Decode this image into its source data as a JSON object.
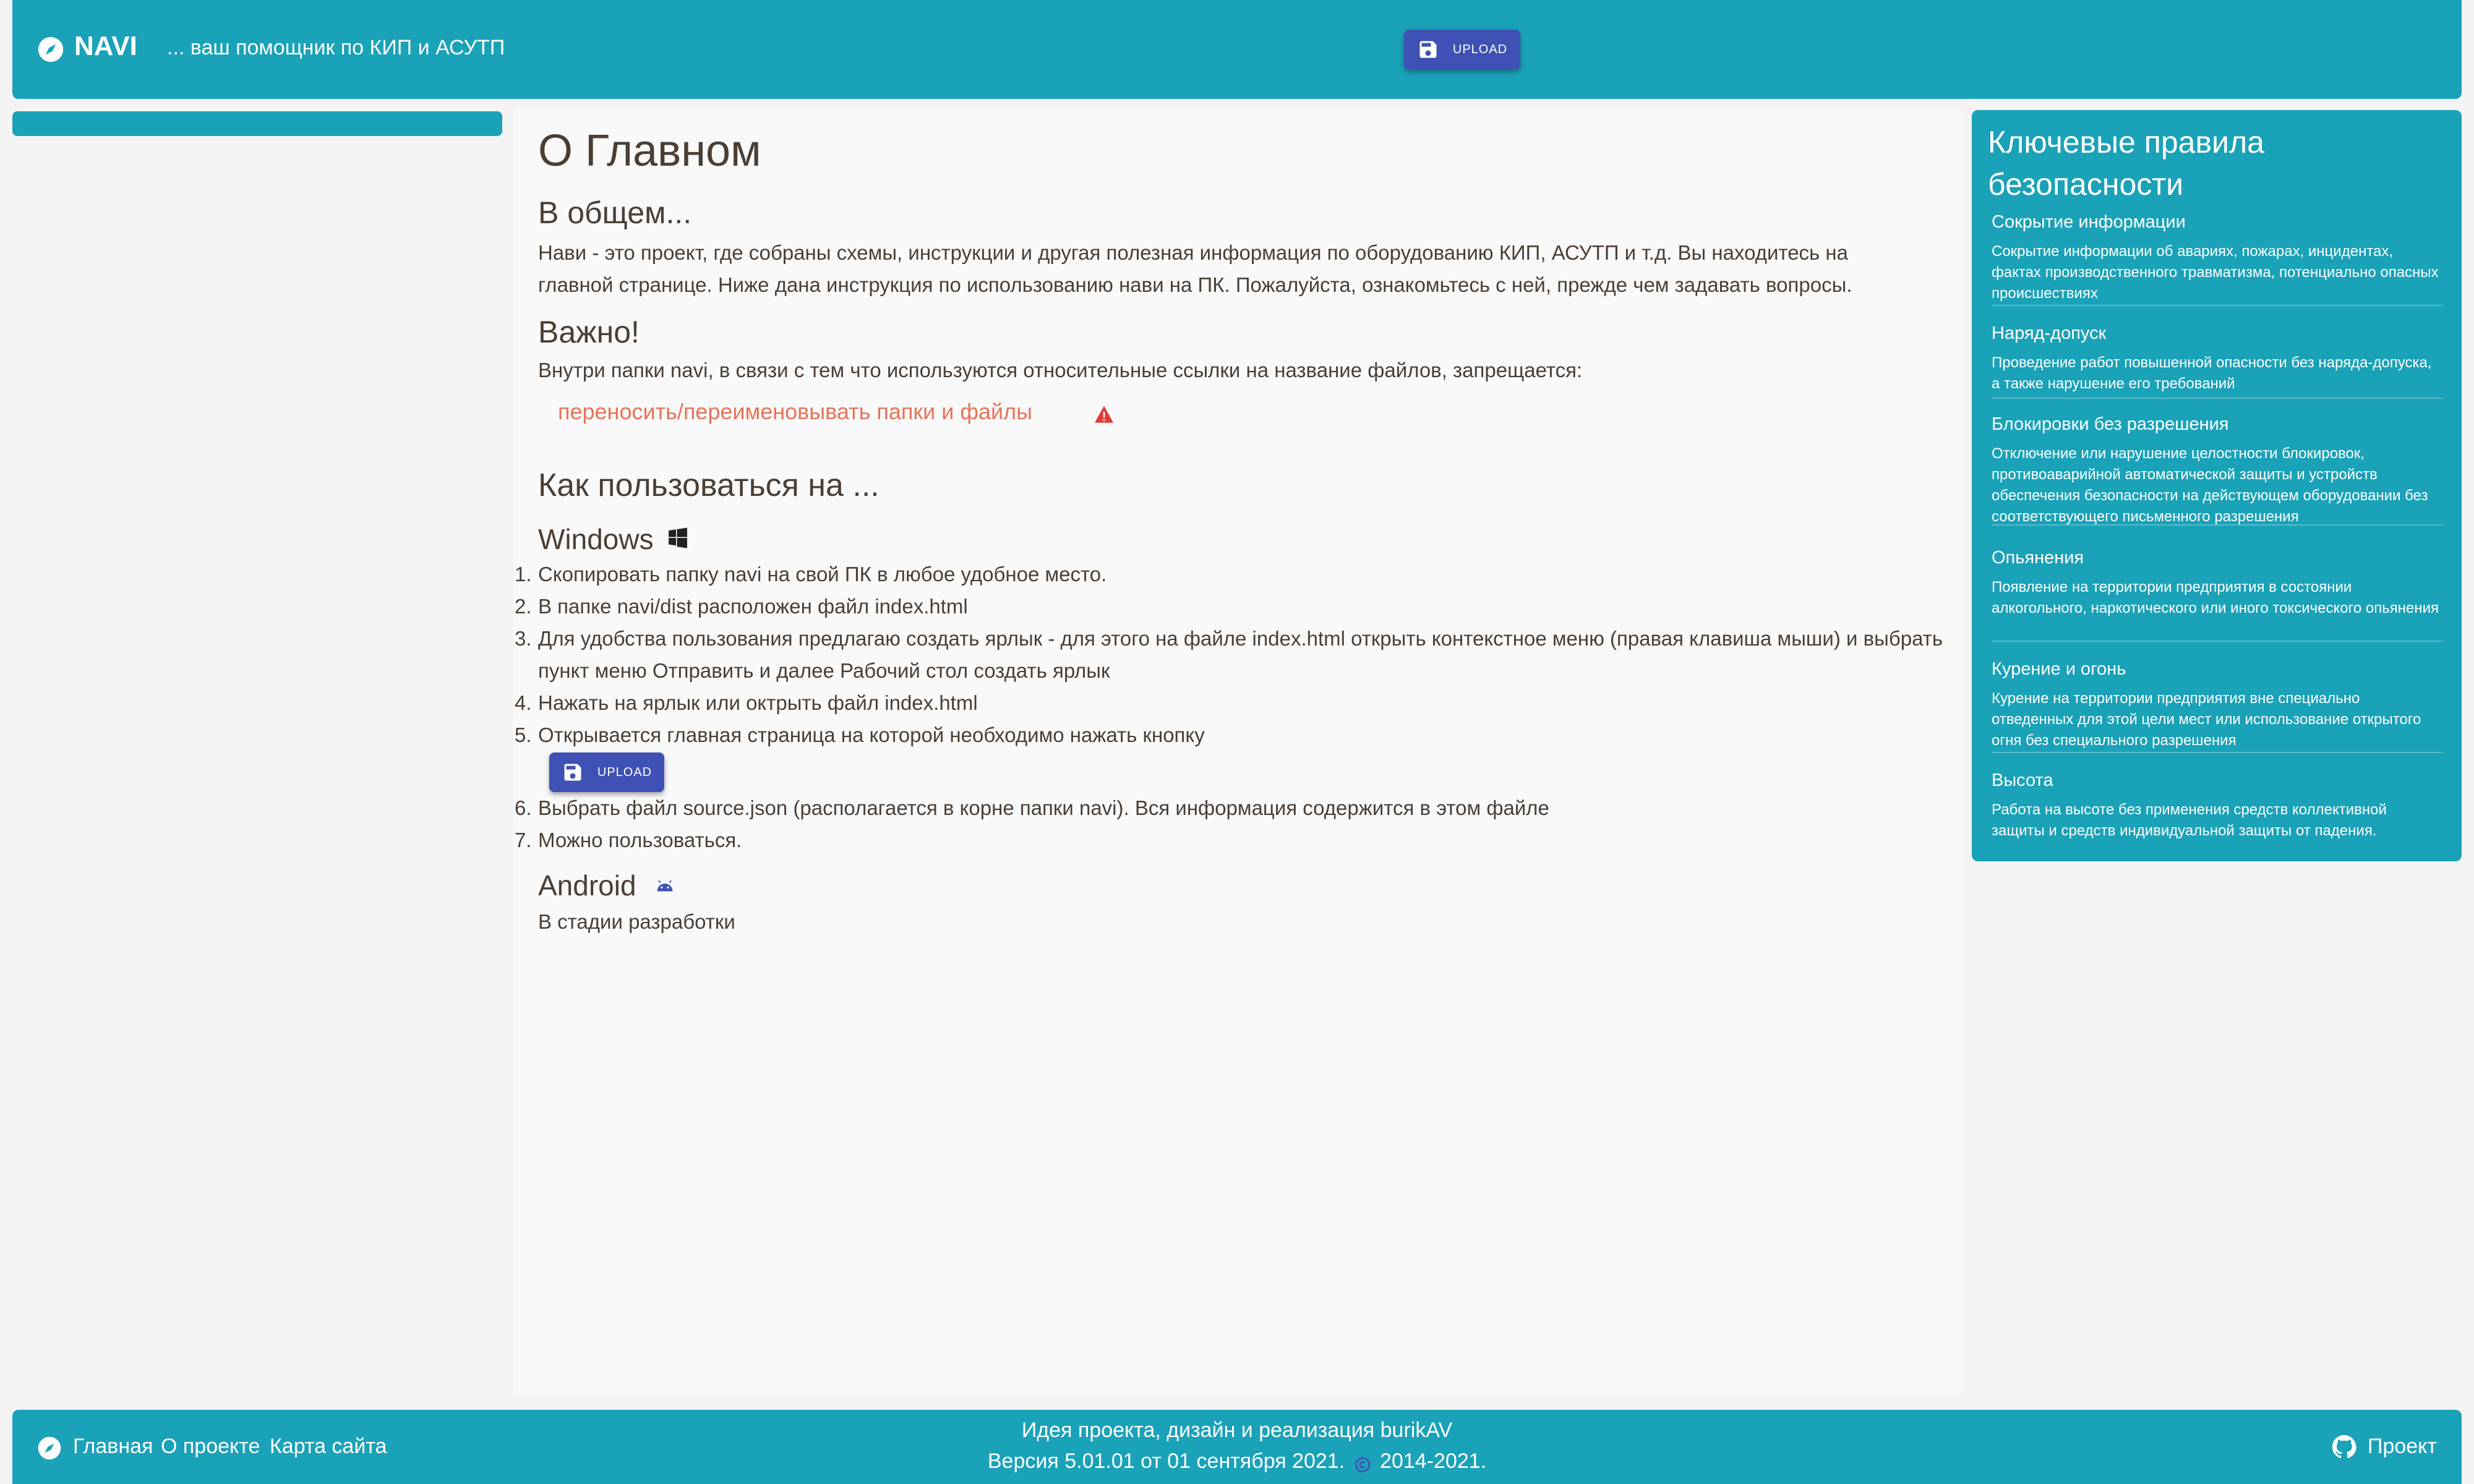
{
  "header": {
    "brand": "NAVI",
    "subtitle": "... ваш помощник по КИП и АСУТП",
    "upload_label": "UPLOAD",
    "logo_icon": "compass-icon"
  },
  "main": {
    "title": "О Главном",
    "general_heading": "В общем...",
    "general_text": "Нави - это проект, где собраны схемы, инструкции и другая полезная информация по оборудованию КИП, АСУТП и т.д. Вы находитесь на главной странице. Ниже дана инструкция по использованию нави на ПК. Пожалуйста, ознакомьтесь с ней, прежде чем задавать вопросы.",
    "important_heading": "Важно!",
    "important_text": "Внутри папки navi, в связи с тем что используются относительные ссылки на название файлов, запрещается:",
    "warning_text": "переносить/переименовывать папки и файлы",
    "howto_heading": "Как пользоваться на ...",
    "windows_heading": "Windows",
    "steps": [
      {
        "num": "1.",
        "text": "Скопировать папку navi на свой ПК в любое удобное место."
      },
      {
        "num": "2.",
        "text": "В папке navi/dist расположен файл index.html"
      },
      {
        "num": "3.",
        "text": "Для удобства пользования предлагаю создать ярлык - для этого на файле index.html открыть контекстное меню (правая клавиша мыши) и выбрать",
        "text2": "пункт меню Отправить и далее Рабочий стол создать ярлык"
      },
      {
        "num": "4.",
        "text": "Нажать на ярлык или октрыть файл index.html"
      },
      {
        "num": "5.",
        "text": "Открывается главная страница на которой необходимо нажать кнопку"
      },
      {
        "num": "6.",
        "text": "Выбрать файл source.json (располагается в корне папки navi). Вся информация содержится в этом файле"
      },
      {
        "num": "7.",
        "text": "Можно пользоваться."
      }
    ],
    "upload_label": "UPLOAD",
    "android_heading": "Android",
    "android_text": "В стадии разработки"
  },
  "safety": {
    "title": "Ключевые правила безопасности",
    "rules": [
      {
        "title": "Сокрытие информации",
        "text": "Сокрытие информации об авариях, пожарах, инцидентах, фактах производственного травматизма, потенциально опасных происшествиях"
      },
      {
        "title": "Наряд-допуск",
        "text": "Проведение работ повышенной опасности без наряда-допуска, а также нарушение его требований"
      },
      {
        "title": "Блокировки без разрешения",
        "text": "Отключение или нарушение целостности блокировок, противоаварийной автоматической защиты и устройств обеспечения безопасности на действующем оборудовании без соответствующего письменного разрешения"
      },
      {
        "title": "Опьянения",
        "text": "Появление на территории предприятия в состоянии алкогольного, наркотического или иного токсического опьянения"
      },
      {
        "title": "Курение и огонь",
        "text": "Курение на территории предприятия вне специально отведенных для этой цели мест или использование открытого огня без специального разрешения"
      },
      {
        "title": "Высота",
        "text": "Работа на высоте без применения средств коллективной защиты и средств индивидуальной защиты от падения."
      }
    ]
  },
  "footer": {
    "links": [
      "Главная",
      "О проекте",
      "Карта сайта"
    ],
    "credit": "Идея проекта, дизайн и реализация burikAV",
    "version_prefix": "Версия 5.01.01 от 01 сентября 2021.",
    "years": "2014-2021.",
    "project_link": "Проект"
  },
  "colors": {
    "accent": "#1aa2b8",
    "button": "#3f51b5",
    "warning": "#e8735a"
  }
}
